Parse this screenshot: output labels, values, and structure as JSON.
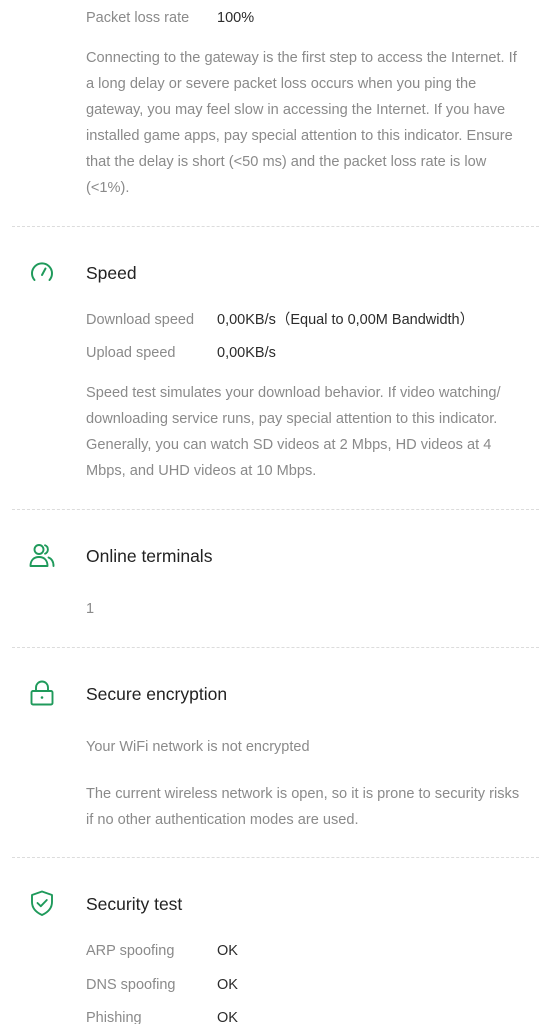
{
  "top": {
    "packet_loss_label": "Packet loss rate",
    "packet_loss_value": "100%",
    "description": "Connecting to the gateway is the first step to access the Internet. If a long delay or severe packet loss occurs when you ping the gateway, you may feel slow in accessing the Internet. If you have installed game apps, pay special attention to this indicator. Ensure that the delay is short (<50 ms) and the packet loss rate is low (<1%)."
  },
  "speed": {
    "icon": "speedometer-icon",
    "title": "Speed",
    "download_label": "Download speed",
    "download_value": "0,00KB/s（Equal to 0,00M Bandwidth）",
    "upload_label": "Upload speed",
    "upload_value": "0,00KB/s",
    "description": "Speed test simulates your download behavior. If video watching/ downloading service runs, pay special attention to this indicator. Generally, you can watch SD videos at 2 Mbps, HD videos at 4 Mbps, and UHD videos at 10 Mbps."
  },
  "terminals": {
    "icon": "users-icon",
    "title": "Online terminals",
    "count": "1"
  },
  "encryption": {
    "icon": "lock-icon",
    "title": "Secure encryption",
    "status": "Your WiFi network is not encrypted",
    "description": "The current wireless network is open, so it is prone to security risks if no other authentication modes are used."
  },
  "security": {
    "icon": "shield-check-icon",
    "title": "Security test",
    "items": [
      {
        "label": "ARP spoofing",
        "value": "OK"
      },
      {
        "label": "DNS spoofing",
        "value": "OK"
      },
      {
        "label": "Phishing",
        "value": "OK"
      }
    ]
  },
  "colors": {
    "accent": "#1f9a5b",
    "label": "#8a8a8a",
    "value": "#2b2b2b",
    "divider": "#dcdcdc"
  }
}
